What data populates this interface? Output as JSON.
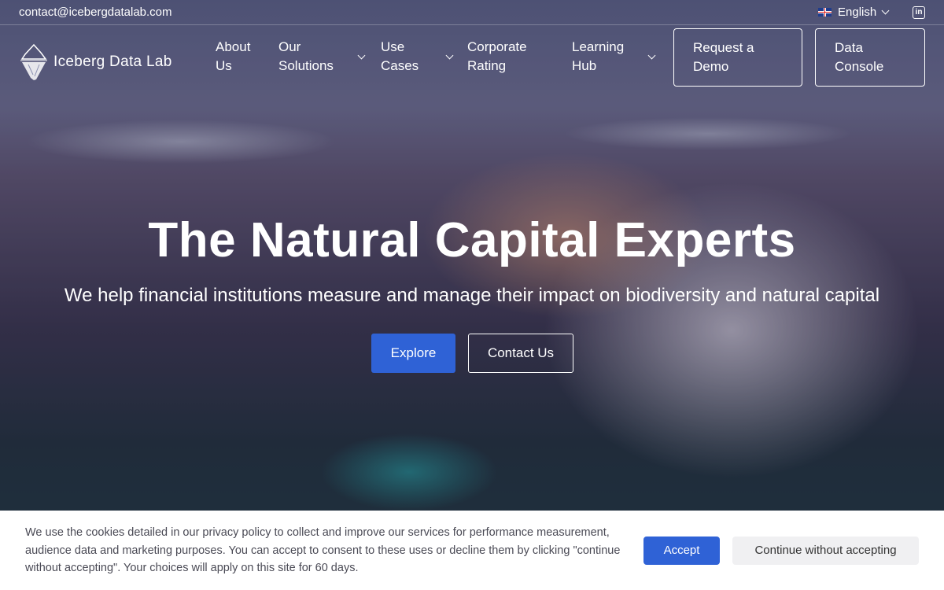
{
  "topbar": {
    "email": "contact@icebergdatalab.com",
    "language": "English",
    "linkedin_label": "in"
  },
  "brand": {
    "name": "Iceberg Data Lab"
  },
  "nav": {
    "items": [
      {
        "label": "About Us",
        "has_dropdown": false
      },
      {
        "label": "Our Solutions",
        "has_dropdown": true
      },
      {
        "label": "Use Cases",
        "has_dropdown": true
      },
      {
        "label": "Corporate Rating",
        "has_dropdown": false
      },
      {
        "label": "Learning Hub",
        "has_dropdown": true
      }
    ],
    "request_demo": "Request a Demo",
    "data_console": "Data Console"
  },
  "hero": {
    "title": "The Natural Capital Experts",
    "subtitle": "We help financial institutions measure and manage their impact on biodiversity and natural capital",
    "explore": "Explore",
    "contact": "Contact Us"
  },
  "cookie": {
    "text": "We use the cookies detailed in our privacy policy to collect and improve our services for performance measurement, audience data and marketing purposes. You can accept to consent to these uses or decline them by clicking \"continue without accepting\". Your choices will apply on this site for 60 days.",
    "accept": "Accept",
    "decline": "Continue without accepting"
  },
  "colors": {
    "accent": "#2f62d6",
    "cookie_bg": "#ffffff",
    "secondary_button": "#f0f0f2"
  }
}
